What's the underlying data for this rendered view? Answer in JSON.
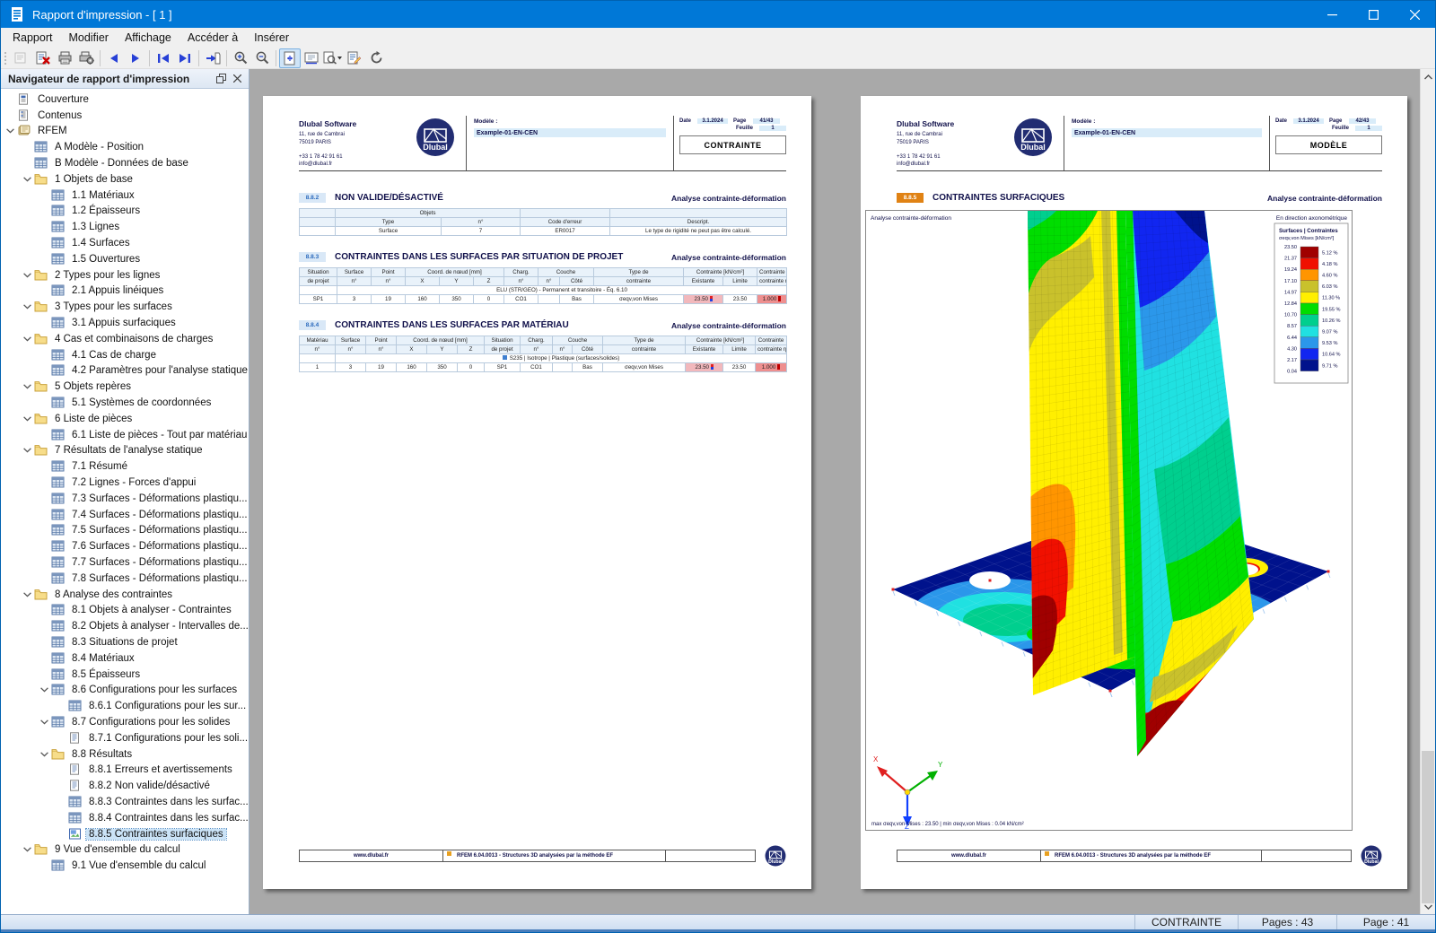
{
  "window": {
    "title": "Rapport d'impression - [ 1 ]"
  },
  "menu": [
    "Rapport",
    "Modifier",
    "Affichage",
    "Accéder à",
    "Insérer"
  ],
  "toolbar": [
    {
      "icon": "open-report",
      "disabled": true
    },
    {
      "icon": "delete-page"
    },
    {
      "icon": "print"
    },
    {
      "icon": "print-setup"
    },
    {
      "sep": true
    },
    {
      "icon": "prev-page"
    },
    {
      "icon": "next-page"
    },
    {
      "sep": true
    },
    {
      "icon": "first-page"
    },
    {
      "icon": "last-page"
    },
    {
      "sep": true
    },
    {
      "icon": "goto-page"
    },
    {
      "sep": true
    },
    {
      "icon": "zoom-in"
    },
    {
      "icon": "zoom-out"
    },
    {
      "sep": true
    },
    {
      "icon": "fit-page",
      "active": true
    },
    {
      "icon": "fit-width"
    },
    {
      "icon": "preview-dropdown"
    },
    {
      "icon": "edit-page"
    },
    {
      "icon": "refresh"
    }
  ],
  "navigator": {
    "title": "Navigateur de rapport d'impression",
    "items": [
      {
        "label": "Couverture",
        "level": 1,
        "icon": "doc-cover"
      },
      {
        "label": "Contenus",
        "level": 1,
        "icon": "doc-toc"
      },
      {
        "label": "RFEM",
        "level": 1,
        "icon": "rfem",
        "chevron": true
      },
      {
        "label": "A Modèle - Position",
        "level": 2,
        "icon": "table"
      },
      {
        "label": "B Modèle - Données de base",
        "level": 2,
        "icon": "table"
      },
      {
        "label": "1 Objets de base",
        "level": 2,
        "icon": "folder",
        "chevron": true
      },
      {
        "label": "1.1 Matériaux",
        "level": 3,
        "icon": "table"
      },
      {
        "label": "1.2 Épaisseurs",
        "level": 3,
        "icon": "table"
      },
      {
        "label": "1.3 Lignes",
        "level": 3,
        "icon": "table"
      },
      {
        "label": "1.4 Surfaces",
        "level": 3,
        "icon": "table"
      },
      {
        "label": "1.5 Ouvertures",
        "level": 3,
        "icon": "table"
      },
      {
        "label": "2 Types pour les lignes",
        "level": 2,
        "icon": "folder",
        "chevron": true
      },
      {
        "label": "2.1 Appuis linéiques",
        "level": 3,
        "icon": "table"
      },
      {
        "label": "3 Types pour les surfaces",
        "level": 2,
        "icon": "folder",
        "chevron": true
      },
      {
        "label": "3.1 Appuis surfaciques",
        "level": 3,
        "icon": "table"
      },
      {
        "label": "4 Cas et combinaisons de charges",
        "level": 2,
        "icon": "folder",
        "chevron": true
      },
      {
        "label": "4.1 Cas de charge",
        "level": 3,
        "icon": "table"
      },
      {
        "label": "4.2 Paramètres pour l'analyse statique",
        "level": 3,
        "icon": "table"
      },
      {
        "label": "5 Objets repères",
        "level": 2,
        "icon": "folder",
        "chevron": true
      },
      {
        "label": "5.1 Systèmes de coordonnées",
        "level": 3,
        "icon": "table"
      },
      {
        "label": "6 Liste de pièces",
        "level": 2,
        "icon": "folder",
        "chevron": true
      },
      {
        "label": "6.1 Liste de pièces - Tout par matériau",
        "level": 3,
        "icon": "table"
      },
      {
        "label": "7 Résultats de l'analyse statique",
        "level": 2,
        "icon": "folder",
        "chevron": true
      },
      {
        "label": "7.1 Résumé",
        "level": 3,
        "icon": "table"
      },
      {
        "label": "7.2 Lignes - Forces d'appui",
        "level": 3,
        "icon": "table"
      },
      {
        "label": "7.3 Surfaces - Déformations plastiqu...",
        "level": 3,
        "icon": "table"
      },
      {
        "label": "7.4 Surfaces - Déformations plastiqu...",
        "level": 3,
        "icon": "table"
      },
      {
        "label": "7.5 Surfaces - Déformations plastiqu...",
        "level": 3,
        "icon": "table"
      },
      {
        "label": "7.6 Surfaces - Déformations plastiqu...",
        "level": 3,
        "icon": "table"
      },
      {
        "label": "7.7 Surfaces - Déformations plastiqu...",
        "level": 3,
        "icon": "table"
      },
      {
        "label": "7.8 Surfaces - Déformations plastiqu...",
        "level": 3,
        "icon": "table"
      },
      {
        "label": "8 Analyse des contraintes",
        "level": 2,
        "icon": "folder",
        "chevron": true
      },
      {
        "label": "8.1 Objets à analyser - Contraintes",
        "level": 3,
        "icon": "table"
      },
      {
        "label": "8.2 Objets à analyser - Intervalles de...",
        "level": 3,
        "icon": "table"
      },
      {
        "label": "8.3 Situations de projet",
        "level": 3,
        "icon": "table"
      },
      {
        "label": "8.4 Matériaux",
        "level": 3,
        "icon": "table"
      },
      {
        "label": "8.5 Épaisseurs",
        "level": 3,
        "icon": "table"
      },
      {
        "label": "8.6 Configurations pour les surfaces",
        "level": 3,
        "icon": "table",
        "chevron": true
      },
      {
        "label": "8.6.1 Configurations pour les sur...",
        "level": 4,
        "icon": "table"
      },
      {
        "label": "8.7 Configurations pour les solides",
        "level": 3,
        "icon": "table",
        "chevron": true
      },
      {
        "label": "8.7.1 Configurations pour les soli...",
        "level": 4,
        "icon": "doc"
      },
      {
        "label": "8.8 Résultats",
        "level": 3,
        "icon": "folder",
        "chevron": true
      },
      {
        "label": "8.8.1 Erreurs et avertissements",
        "level": 4,
        "icon": "doc"
      },
      {
        "label": "8.8.2 Non valide/désactivé",
        "level": 4,
        "icon": "doc"
      },
      {
        "label": "8.8.3 Contraintes dans les surfac...",
        "level": 4,
        "icon": "table"
      },
      {
        "label": "8.8.4 Contraintes dans les surfac...",
        "level": 4,
        "icon": "table"
      },
      {
        "label": "8.8.5 Contraintes surfaciques",
        "level": 4,
        "icon": "image",
        "selected": true
      },
      {
        "label": "9 Vue d'ensemble du calcul",
        "level": 2,
        "icon": "folder",
        "chevron": true
      },
      {
        "label": "9.1 Vue d'ensemble du calcul",
        "level": 3,
        "icon": "table"
      }
    ]
  },
  "pages": [
    {
      "company": "Dlubal Software",
      "addr1": "11, rue de Cambrai",
      "addr2": "75019 PARIS",
      "phone": "+33 1 78 42 91 61",
      "email": "info@dlubal.fr",
      "logo_text": "Dlubal",
      "modele_label": "Modèle :",
      "modele_value": "Example-01-EN-CEN",
      "date_label": "Date",
      "date_value": "3.1.2024",
      "page_label": "Page",
      "page_value": "41/43",
      "feuille_label": "Feuille",
      "feuille_value": "1",
      "box_label": "CONTRAINTE",
      "footer_site": "www.dlubal.fr",
      "footer_app": "RFEM 6.04.0013 - Structures 3D analysées par la méthode EF"
    },
    {
      "company": "Dlubal Software",
      "addr1": "11, rue de Cambrai",
      "addr2": "75019 PARIS",
      "phone": "+33 1 78 42 91 61",
      "email": "info@dlubal.fr",
      "logo_text": "Dlubal",
      "modele_label": "Modèle :",
      "modele_value": "Example-01-EN-CEN",
      "date_label": "Date",
      "date_value": "3.1.2024",
      "page_label": "Page",
      "page_value": "42/43",
      "feuille_label": "Feuille",
      "feuille_value": "1",
      "box_label": "MODÈLE",
      "footer_site": "www.dlubal.fr",
      "footer_app": "RFEM 6.04.0013 - Structures 3D analysées par la méthode EF"
    }
  ],
  "page1_sections": [
    {
      "badge": "8.8.2",
      "title": "NON VALIDE/DÉSACTIVÉ",
      "right": "Analyse contrainte-déformation",
      "table": {
        "widths": [
          40,
          118,
          88,
          100,
          197
        ],
        "head": [
          [
            {
              "t": ""
            },
            {
              "t": "Objets",
              "cs": 2
            },
            {
              "t": ""
            },
            {
              "t": ""
            }
          ],
          [
            {
              "t": ""
            },
            {
              "t": "Type"
            },
            {
              "t": "n°"
            },
            {
              "t": "Code d'erreur"
            },
            {
              "t": "Descript."
            }
          ]
        ],
        "rows": [
          [
            {
              "t": ""
            },
            {
              "t": "Surface",
              "a": "l"
            },
            {
              "t": "7",
              "a": "l"
            },
            {
              "t": "ER0017",
              "a": "r"
            },
            {
              "t": "Le type de rigidité ne peut pas être calculé.",
              "a": "l"
            }
          ]
        ]
      }
    },
    {
      "badge": "8.8.3",
      "title": "CONTRAINTES DANS LES SURFACES PAR SITUATION DE PROJET",
      "right": "Analyse contrainte-déformation",
      "table": {
        "widths": [
          42,
          38,
          38,
          38,
          38,
          34,
          38,
          24,
          38,
          100,
          44,
          38,
          33
        ],
        "head": [
          [
            {
              "t": "Situation"
            },
            {
              "t": "Surface"
            },
            {
              "t": "Point"
            },
            {
              "t": "Coord. de nœud [mm]",
              "cs": 3
            },
            {
              "t": "Charg."
            },
            {
              "t": "Couche",
              "cs": 2
            },
            {
              "t": "Type de"
            },
            {
              "t": "Contrainte [kN/cm²]",
              "cs": 2
            },
            {
              "t": "Contrainte"
            }
          ],
          [
            {
              "t": "de projet"
            },
            {
              "t": "n°"
            },
            {
              "t": "n°"
            },
            {
              "t": "X"
            },
            {
              "t": "Y"
            },
            {
              "t": "Z"
            },
            {
              "t": "n°"
            },
            {
              "t": "n°"
            },
            {
              "t": "Côté"
            },
            {
              "t": "contrainte"
            },
            {
              "t": "Existante"
            },
            {
              "t": "Limite"
            },
            {
              "t": "contrainte η [-]"
            }
          ]
        ],
        "rows": [
          [
            {
              "t": ""
            },
            {
              "t": "ELU (STR/GEO) - Permanent et transitoire - Éq. 6.10",
              "cs": 12,
              "a": "l",
              "cls": "group"
            }
          ],
          [
            {
              "t": "SP1"
            },
            {
              "t": "3"
            },
            {
              "t": "19"
            },
            {
              "t": "160",
              "a": "r"
            },
            {
              "t": "350",
              "a": "r"
            },
            {
              "t": "0",
              "a": "r"
            },
            {
              "t": "CO1"
            },
            {
              "t": ""
            },
            {
              "t": "Bas"
            },
            {
              "t": "σeqv,von Mises",
              "a": "l"
            },
            {
              "t": "23.50",
              "a": "r",
              "cls": "pink"
            },
            {
              "t": "23.50",
              "a": "r"
            },
            {
              "t": "1.000",
              "a": "r",
              "cls": "redcell"
            }
          ]
        ]
      }
    },
    {
      "badge": "8.8.4",
      "title": "CONTRAINTES DANS LES SURFACES PAR MATÉRIAU",
      "right": "Analyse contrainte-déformation",
      "table": {
        "widths": [
          40,
          34,
          34,
          34,
          34,
          30,
          40,
          36,
          22,
          34,
          92,
          42,
          36,
          35
        ],
        "head": [
          [
            {
              "t": "Matériau"
            },
            {
              "t": "Surface"
            },
            {
              "t": "Point"
            },
            {
              "t": "Coord. de nœud [mm]",
              "cs": 3
            },
            {
              "t": "Situation"
            },
            {
              "t": "Charg."
            },
            {
              "t": "Couche",
              "cs": 2
            },
            {
              "t": "Type de"
            },
            {
              "t": "Contrainte [kN/cm²]",
              "cs": 2
            },
            {
              "t": "Contrainte"
            }
          ],
          [
            {
              "t": "n°"
            },
            {
              "t": "n°"
            },
            {
              "t": "n°"
            },
            {
              "t": "X"
            },
            {
              "t": "Y"
            },
            {
              "t": "Z"
            },
            {
              "t": "de projet"
            },
            {
              "t": "n°"
            },
            {
              "t": "n°"
            },
            {
              "t": "Côté"
            },
            {
              "t": "contrainte"
            },
            {
              "t": "Existante"
            },
            {
              "t": "Limite"
            },
            {
              "t": "contrainte η [-]"
            }
          ]
        ],
        "rows": [
          [
            {
              "t": ""
            },
            {
              "t": "S235 | Isotrope | Plastique (surfaces/solides)",
              "cs": 13,
              "a": "l",
              "cls": "group",
              "mat": true
            }
          ],
          [
            {
              "t": "1"
            },
            {
              "t": "3"
            },
            {
              "t": "19"
            },
            {
              "t": "160",
              "a": "r"
            },
            {
              "t": "350",
              "a": "r"
            },
            {
              "t": "0",
              "a": "r"
            },
            {
              "t": "SP1"
            },
            {
              "t": "CO1"
            },
            {
              "t": ""
            },
            {
              "t": "Bas"
            },
            {
              "t": "σeqv,von Mises",
              "a": "l"
            },
            {
              "t": "23.50",
              "a": "r",
              "cls": "pink"
            },
            {
              "t": "23.50",
              "a": "r"
            },
            {
              "t": "1.000",
              "a": "r",
              "cls": "redcell"
            }
          ]
        ]
      }
    }
  ],
  "page2_section": {
    "badge": "8.8.5",
    "title": "CONTRAINTES SURFACIQUES",
    "right": "Analyse contrainte-déformation",
    "plot": {
      "top_left": "Analyse contrainte-déformation",
      "top_right": "En direction axonométrique",
      "legend": {
        "title": "Surfaces | Contraintes",
        "subtitle": "σeqv,von Mises [kN/cm²]",
        "values": [
          "23.50",
          "21.37",
          "19.24",
          "17.10",
          "14.97",
          "12.84",
          "10.70",
          "8.57",
          "6.44",
          "4.30",
          "2.17",
          "0.04"
        ],
        "percents": [
          "5.12 %",
          "4.18 %",
          "4.60 %",
          "6.03 %",
          "11.30 %",
          "19.55 %",
          "10.26 %",
          "9.07 %",
          "9.53 %",
          "10.64 %",
          "9.71 %"
        ],
        "colors": [
          "#a00000",
          "#f01000",
          "#ff9500",
          "#c9c12c",
          "#ffef00",
          "#00dd00",
          "#00cf8e",
          "#20e1e1",
          "#2b97ea",
          "#1126f0",
          "#00128c"
        ]
      },
      "axes": {
        "x": "X",
        "y": "Y",
        "z": "Z",
        "x_color": "#e02020",
        "y_color": "#00b000",
        "z_color": "#1040ff"
      },
      "maxmin": "max σeqv,von Mises : 23.50  |  min σeqv,von Mises : 0.04 kN/cm²"
    }
  },
  "statusbar": {
    "mode": "CONTRAINTE",
    "pages": "Pages : 43",
    "page": "Page : 41"
  }
}
